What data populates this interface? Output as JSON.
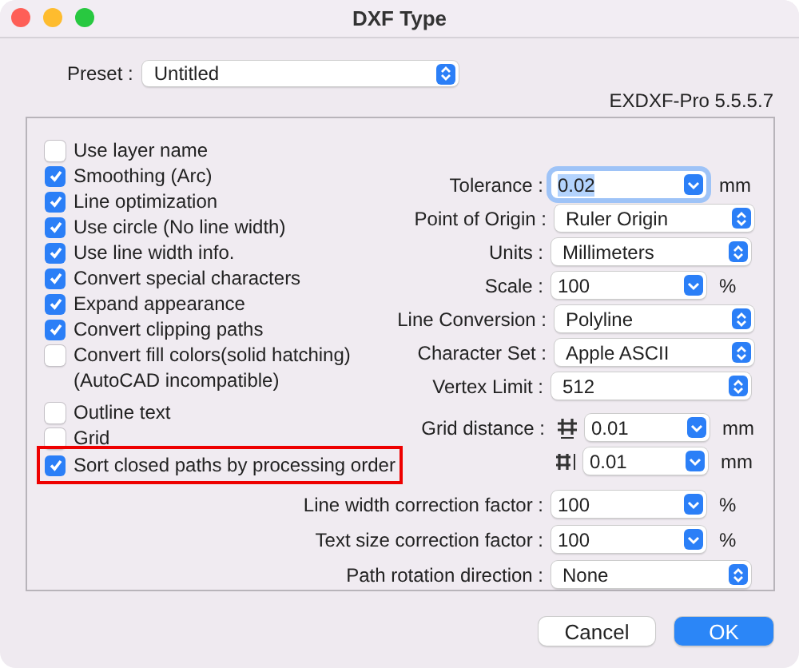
{
  "window": {
    "title": "DXF Type"
  },
  "preset": {
    "label": "Preset :",
    "value": "Untitled"
  },
  "version": "EXDXF-Pro 5.5.5.7",
  "options": [
    {
      "label": "Use layer name",
      "checked": false,
      "highlighted": false
    },
    {
      "label": "Smoothing (Arc)",
      "checked": true,
      "highlighted": false
    },
    {
      "label": "Line optimization",
      "checked": true,
      "highlighted": false
    },
    {
      "label": "Use circle (No line width)",
      "checked": true,
      "highlighted": false
    },
    {
      "label": "Use line width info.",
      "checked": true,
      "highlighted": false
    },
    {
      "label": "Convert special characters",
      "checked": true,
      "highlighted": false
    },
    {
      "label": "Expand appearance",
      "checked": true,
      "highlighted": false
    },
    {
      "label": "Convert clipping paths",
      "checked": true,
      "highlighted": false
    },
    {
      "label": "Convert fill colors(solid hatching)\n(AutoCAD incompatible)",
      "checked": false,
      "highlighted": false
    },
    {
      "label": "Outline text",
      "checked": false,
      "highlighted": false
    },
    {
      "label": "Grid",
      "checked": false,
      "highlighted": false
    },
    {
      "label": "Sort closed paths by processing order",
      "checked": true,
      "highlighted": true
    }
  ],
  "settings": [
    {
      "kind": "combo",
      "label": "Tolerance :",
      "value": "0.02",
      "unit": "mm",
      "focused": true
    },
    {
      "kind": "popup",
      "label": "Point of Origin :",
      "value": "Ruler Origin"
    },
    {
      "kind": "popup",
      "label": "Units :",
      "value": "Millimeters"
    },
    {
      "kind": "combo",
      "label": "Scale :",
      "value": "100",
      "unit": "%",
      "focused": false
    },
    {
      "kind": "popup",
      "label": "Line Conversion :",
      "value": "Polyline"
    },
    {
      "kind": "popup",
      "label": "Character Set :",
      "value": "Apple ASCII"
    },
    {
      "kind": "popup",
      "label": "Vertex Limit :",
      "value": "512"
    },
    {
      "kind": "grid",
      "label": "Grid distance :",
      "value": "0.01",
      "unit": "mm",
      "focused": false
    },
    {
      "kind": "grid",
      "value": "0.01",
      "unit": "mm",
      "focused": false
    }
  ],
  "factors": [
    {
      "kind": "combo",
      "label": "Line width correction factor :",
      "value": "100",
      "unit": "%",
      "focused": false
    },
    {
      "kind": "combo",
      "label": "Text size correction factor :",
      "value": "100",
      "unit": "%",
      "focused": false
    },
    {
      "kind": "popup",
      "label": "Path rotation direction :",
      "value": "None"
    }
  ],
  "buttons": [
    {
      "label": "Cancel",
      "kind": "cancel"
    },
    {
      "label": "OK",
      "kind": "default"
    }
  ]
}
